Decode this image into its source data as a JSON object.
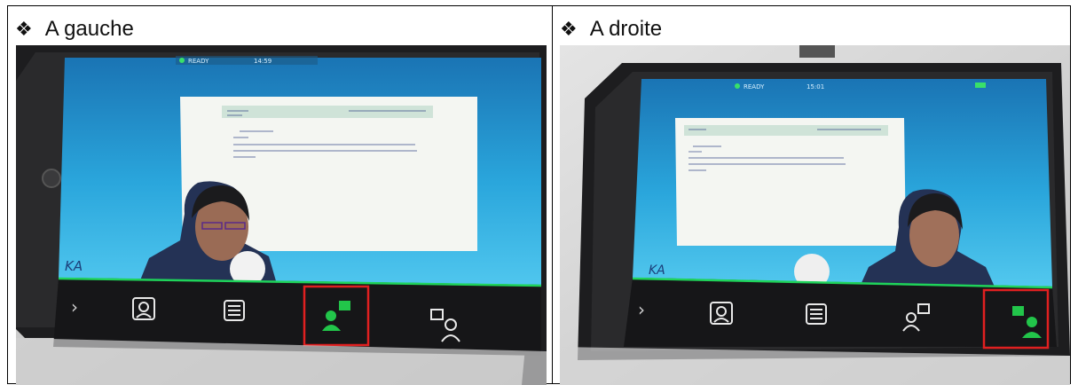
{
  "cells": [
    {
      "heading": "A gauche",
      "bullet": "❖",
      "status": "READY",
      "time": "14:59",
      "logo": "KA",
      "highlighted_button": "reader-presence-button"
    },
    {
      "heading": "A droite",
      "bullet": "❖",
      "status": "READY",
      "time": "15:01",
      "logo": "KA",
      "highlighted_button": "presence-reader-button"
    }
  ],
  "colors": {
    "screen_blue": "#2aa6dc",
    "toolbar_green_line": "#1fd35a",
    "active_icon_green": "#22c54a",
    "highlight_box": "#e02020"
  }
}
